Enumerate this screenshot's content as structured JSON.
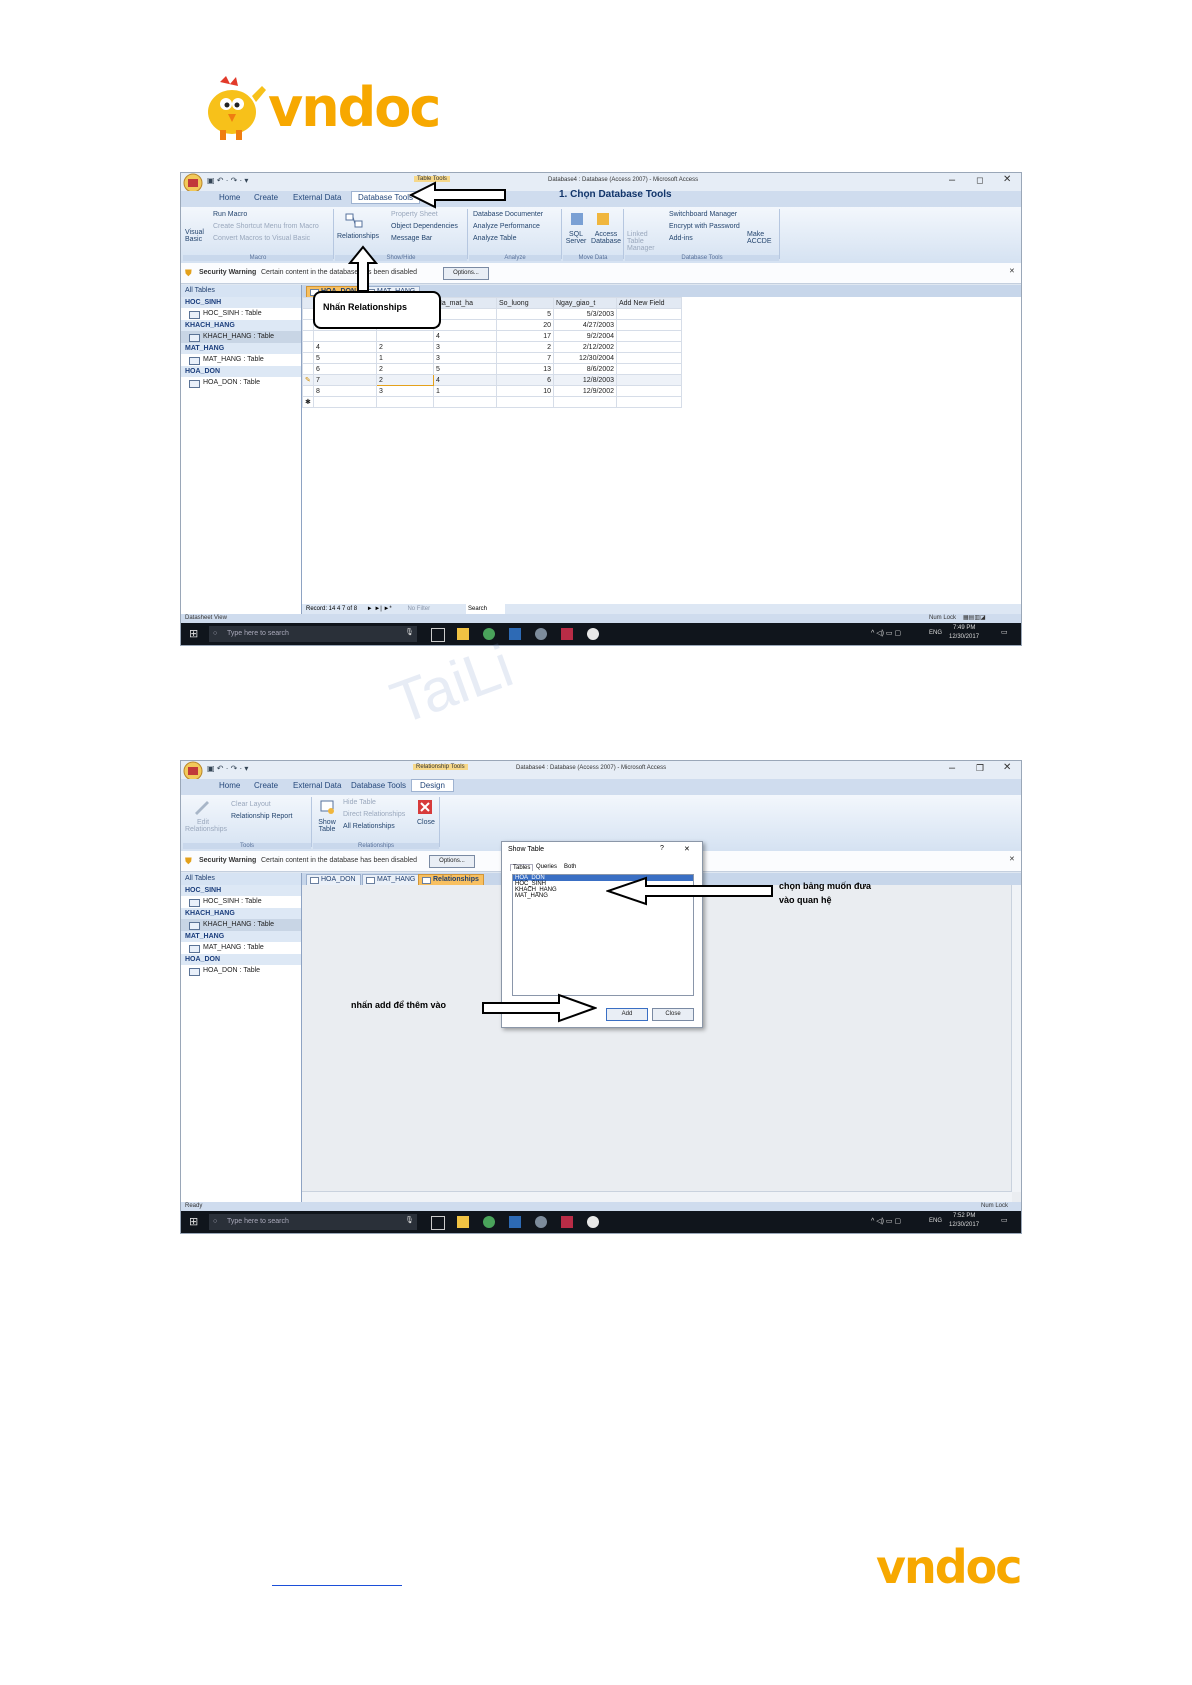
{
  "logos": {
    "top": "vndoc",
    "bottom": "vndoc"
  },
  "watermark": "TaiLi",
  "shot1": {
    "title_context": "Table Tools",
    "window_title": "Database4 : Database (Access 2007) - Microsoft Access",
    "tabs": [
      "Home",
      "Create",
      "External Data",
      "Database Tools"
    ],
    "ribbon": {
      "macro": {
        "run_macro": "Run Macro",
        "create_shortcut": "Create Shortcut Menu from Macro",
        "convert_macros": "Convert Macros to Visual Basic",
        "visual_basic": "Visual Basic",
        "label": "Macro"
      },
      "showhide": {
        "relationships": "Relationships",
        "property_sheet": "Property Sheet",
        "object_dependencies": "Object Dependencies",
        "message_bar": "Message Bar",
        "label": "Show/Hide"
      },
      "analyze": {
        "documenter": "Database Documenter",
        "performance": "Analyze Performance",
        "table": "Analyze Table",
        "label": "Analyze"
      },
      "movedata": {
        "sql": "SQL Server",
        "access": "Access Database",
        "label": "Move Data"
      },
      "dbtools": {
        "linked": "Linked Table Manager",
        "switchboard": "Switchboard Manager",
        "encrypt": "Encrypt with Password",
        "addins": "Add-ins",
        "accde": "Make ACCDE",
        "label": "Database Tools"
      }
    },
    "security_warning": "Security Warning",
    "security_text": "Certain content in the database has been disabled",
    "options_button": "Options...",
    "nav_header": "All Tables",
    "nav_groups": [
      {
        "name": "HOC_SINH",
        "item": "HOC_SINH : Table"
      },
      {
        "name": "KHACH_HANG",
        "item": "KHACH_HANG : Table"
      },
      {
        "name": "MAT_HANG",
        "item": "MAT_HANG : Table"
      },
      {
        "name": "HOA_DON",
        "item": "HOA_DON : Table"
      }
    ],
    "doc_tabs": [
      "HOA_DON",
      "MAT_HANG"
    ],
    "grid_headers": [
      "Ma_mat_ha",
      "So_luong",
      "Ngay_giao_t",
      "Add New Field"
    ],
    "rows": [
      [
        "",
        "",
        "1",
        "5",
        "5/3/2003"
      ],
      [
        "",
        "",
        "5",
        "20",
        "4/27/2003"
      ],
      [
        "",
        "",
        "4",
        "17",
        "9/2/2004"
      ],
      [
        "4",
        "2",
        "3",
        "2",
        "2/12/2002"
      ],
      [
        "5",
        "1",
        "3",
        "7",
        "12/30/2004"
      ],
      [
        "6",
        "2",
        "5",
        "13",
        "8/6/2002"
      ],
      [
        "7",
        "2",
        "4",
        "6",
        "12/8/2003"
      ],
      [
        "8",
        "3",
        "1",
        "10",
        "12/9/2002"
      ]
    ],
    "record_nav": "Record: 14  4 7 of 8",
    "no_filter": "No Filter",
    "search": "Search",
    "status_left": "Datasheet View",
    "status_right": "Num Lock",
    "taskbar_search": "Type here to search",
    "tray_lang": "ENG",
    "tray_time": "7:49 PM",
    "tray_date": "12/30/2017",
    "annotation_step": "1. Chọn Database Tools",
    "annotation_callout": "Nhấn Relationships"
  },
  "shot2": {
    "title_context": "Relationship Tools",
    "window_title": "Database4 : Database (Access 2007) - Microsoft Access",
    "tabs": [
      "Home",
      "Create",
      "External Data",
      "Database Tools",
      "Design"
    ],
    "ribbon": {
      "edit_relationships": "Edit Relationships",
      "clear_layout": "Clear Layout",
      "relationship_report": "Relationship Report",
      "tools_label": "Tools",
      "show_table": "Show Table",
      "hide_table": "Hide Table",
      "direct_relationships": "Direct Relationships",
      "all_relationships": "All Relationships",
      "close": "Close",
      "relationships_label": "Relationships"
    },
    "security_warning": "Security Warning",
    "security_text": "Certain content in the database has been disabled",
    "options_button": "Options...",
    "nav_header": "All Tables",
    "nav_groups": [
      {
        "name": "HOC_SINH",
        "item": "HOC_SINH : Table"
      },
      {
        "name": "KHACH_HANG",
        "item": "KHACH_HANG : Table"
      },
      {
        "name": "MAT_HANG",
        "item": "MAT_HANG : Table"
      },
      {
        "name": "HOA_DON",
        "item": "HOA_DON : Table"
      }
    ],
    "doc_tabs": [
      "HOA_DON",
      "MAT_HANG",
      "Relationships"
    ],
    "dialog": {
      "title": "Show Table",
      "help": "?",
      "close": "✕",
      "tabs": [
        "Tables",
        "Queries",
        "Both"
      ],
      "list": [
        "HOA_DON",
        "HOC_SINH",
        "KHACH_HANG",
        "MAT_HANG"
      ],
      "add": "Add",
      "close_btn": "Close"
    },
    "status_left": "Ready",
    "status_right": "Num Lock",
    "taskbar_search": "Type here to search",
    "tray_lang": "ENG",
    "tray_time": "7:52 PM",
    "tray_date": "12/30/2017",
    "annotation_select_l1": "chọn bảng muốn đưa",
    "annotation_select_l2": "vào quan hệ",
    "annotation_add": "nhấn add để thêm vào"
  },
  "footer_link": ""
}
